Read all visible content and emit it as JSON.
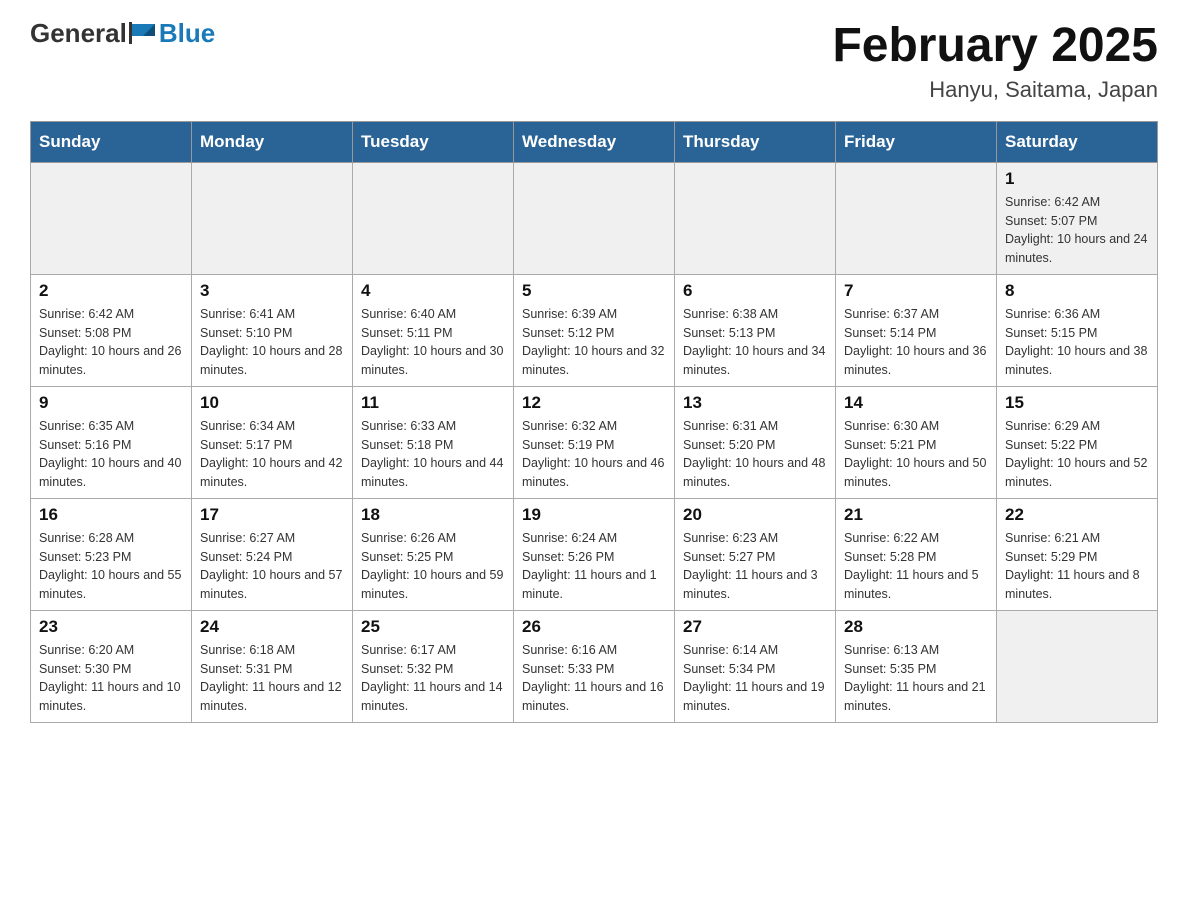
{
  "header": {
    "logo": {
      "general": "General",
      "blue": "Blue"
    },
    "title": "February 2025",
    "location": "Hanyu, Saitama, Japan"
  },
  "weekdays": [
    "Sunday",
    "Monday",
    "Tuesday",
    "Wednesday",
    "Thursday",
    "Friday",
    "Saturday"
  ],
  "weeks": [
    [
      {
        "day": "",
        "sunrise": "",
        "sunset": "",
        "daylight": ""
      },
      {
        "day": "",
        "sunrise": "",
        "sunset": "",
        "daylight": ""
      },
      {
        "day": "",
        "sunrise": "",
        "sunset": "",
        "daylight": ""
      },
      {
        "day": "",
        "sunrise": "",
        "sunset": "",
        "daylight": ""
      },
      {
        "day": "",
        "sunrise": "",
        "sunset": "",
        "daylight": ""
      },
      {
        "day": "",
        "sunrise": "",
        "sunset": "",
        "daylight": ""
      },
      {
        "day": "1",
        "sunrise": "Sunrise: 6:42 AM",
        "sunset": "Sunset: 5:07 PM",
        "daylight": "Daylight: 10 hours and 24 minutes."
      }
    ],
    [
      {
        "day": "2",
        "sunrise": "Sunrise: 6:42 AM",
        "sunset": "Sunset: 5:08 PM",
        "daylight": "Daylight: 10 hours and 26 minutes."
      },
      {
        "day": "3",
        "sunrise": "Sunrise: 6:41 AM",
        "sunset": "Sunset: 5:10 PM",
        "daylight": "Daylight: 10 hours and 28 minutes."
      },
      {
        "day": "4",
        "sunrise": "Sunrise: 6:40 AM",
        "sunset": "Sunset: 5:11 PM",
        "daylight": "Daylight: 10 hours and 30 minutes."
      },
      {
        "day": "5",
        "sunrise": "Sunrise: 6:39 AM",
        "sunset": "Sunset: 5:12 PM",
        "daylight": "Daylight: 10 hours and 32 minutes."
      },
      {
        "day": "6",
        "sunrise": "Sunrise: 6:38 AM",
        "sunset": "Sunset: 5:13 PM",
        "daylight": "Daylight: 10 hours and 34 minutes."
      },
      {
        "day": "7",
        "sunrise": "Sunrise: 6:37 AM",
        "sunset": "Sunset: 5:14 PM",
        "daylight": "Daylight: 10 hours and 36 minutes."
      },
      {
        "day": "8",
        "sunrise": "Sunrise: 6:36 AM",
        "sunset": "Sunset: 5:15 PM",
        "daylight": "Daylight: 10 hours and 38 minutes."
      }
    ],
    [
      {
        "day": "9",
        "sunrise": "Sunrise: 6:35 AM",
        "sunset": "Sunset: 5:16 PM",
        "daylight": "Daylight: 10 hours and 40 minutes."
      },
      {
        "day": "10",
        "sunrise": "Sunrise: 6:34 AM",
        "sunset": "Sunset: 5:17 PM",
        "daylight": "Daylight: 10 hours and 42 minutes."
      },
      {
        "day": "11",
        "sunrise": "Sunrise: 6:33 AM",
        "sunset": "Sunset: 5:18 PM",
        "daylight": "Daylight: 10 hours and 44 minutes."
      },
      {
        "day": "12",
        "sunrise": "Sunrise: 6:32 AM",
        "sunset": "Sunset: 5:19 PM",
        "daylight": "Daylight: 10 hours and 46 minutes."
      },
      {
        "day": "13",
        "sunrise": "Sunrise: 6:31 AM",
        "sunset": "Sunset: 5:20 PM",
        "daylight": "Daylight: 10 hours and 48 minutes."
      },
      {
        "day": "14",
        "sunrise": "Sunrise: 6:30 AM",
        "sunset": "Sunset: 5:21 PM",
        "daylight": "Daylight: 10 hours and 50 minutes."
      },
      {
        "day": "15",
        "sunrise": "Sunrise: 6:29 AM",
        "sunset": "Sunset: 5:22 PM",
        "daylight": "Daylight: 10 hours and 52 minutes."
      }
    ],
    [
      {
        "day": "16",
        "sunrise": "Sunrise: 6:28 AM",
        "sunset": "Sunset: 5:23 PM",
        "daylight": "Daylight: 10 hours and 55 minutes."
      },
      {
        "day": "17",
        "sunrise": "Sunrise: 6:27 AM",
        "sunset": "Sunset: 5:24 PM",
        "daylight": "Daylight: 10 hours and 57 minutes."
      },
      {
        "day": "18",
        "sunrise": "Sunrise: 6:26 AM",
        "sunset": "Sunset: 5:25 PM",
        "daylight": "Daylight: 10 hours and 59 minutes."
      },
      {
        "day": "19",
        "sunrise": "Sunrise: 6:24 AM",
        "sunset": "Sunset: 5:26 PM",
        "daylight": "Daylight: 11 hours and 1 minute."
      },
      {
        "day": "20",
        "sunrise": "Sunrise: 6:23 AM",
        "sunset": "Sunset: 5:27 PM",
        "daylight": "Daylight: 11 hours and 3 minutes."
      },
      {
        "day": "21",
        "sunrise": "Sunrise: 6:22 AM",
        "sunset": "Sunset: 5:28 PM",
        "daylight": "Daylight: 11 hours and 5 minutes."
      },
      {
        "day": "22",
        "sunrise": "Sunrise: 6:21 AM",
        "sunset": "Sunset: 5:29 PM",
        "daylight": "Daylight: 11 hours and 8 minutes."
      }
    ],
    [
      {
        "day": "23",
        "sunrise": "Sunrise: 6:20 AM",
        "sunset": "Sunset: 5:30 PM",
        "daylight": "Daylight: 11 hours and 10 minutes."
      },
      {
        "day": "24",
        "sunrise": "Sunrise: 6:18 AM",
        "sunset": "Sunset: 5:31 PM",
        "daylight": "Daylight: 11 hours and 12 minutes."
      },
      {
        "day": "25",
        "sunrise": "Sunrise: 6:17 AM",
        "sunset": "Sunset: 5:32 PM",
        "daylight": "Daylight: 11 hours and 14 minutes."
      },
      {
        "day": "26",
        "sunrise": "Sunrise: 6:16 AM",
        "sunset": "Sunset: 5:33 PM",
        "daylight": "Daylight: 11 hours and 16 minutes."
      },
      {
        "day": "27",
        "sunrise": "Sunrise: 6:14 AM",
        "sunset": "Sunset: 5:34 PM",
        "daylight": "Daylight: 11 hours and 19 minutes."
      },
      {
        "day": "28",
        "sunrise": "Sunrise: 6:13 AM",
        "sunset": "Sunset: 5:35 PM",
        "daylight": "Daylight: 11 hours and 21 minutes."
      },
      {
        "day": "",
        "sunrise": "",
        "sunset": "",
        "daylight": ""
      }
    ]
  ]
}
